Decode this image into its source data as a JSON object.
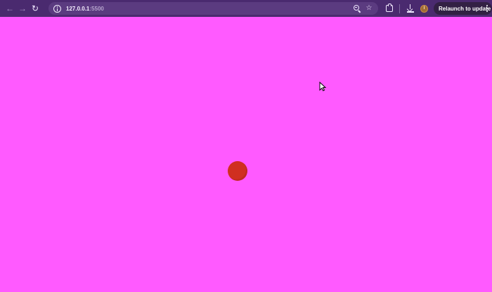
{
  "browser": {
    "toolbar": {
      "back_icon": "arrow-left-icon",
      "forward_icon": "arrow-right-icon",
      "reload_icon": "reload-icon"
    },
    "address_bar": {
      "url_host": "127.0.0.1",
      "url_port": ":5500",
      "site_info_icon": "info-icon",
      "zoom_icon": "zoom-out-icon",
      "bookmark_icon": "star-icon"
    },
    "actions": {
      "extensions_icon": "extensions-icon",
      "downloads_icon": "download-icon",
      "avatar_icon": "profile-avatar-icon",
      "relaunch_label": "Relaunch to update",
      "menu_icon": "more-vertical-icon"
    }
  },
  "page": {
    "background_color": "#ff5aff",
    "ball_color": "#d02f20",
    "cursor_icon": "mouse-pointer-icon"
  }
}
